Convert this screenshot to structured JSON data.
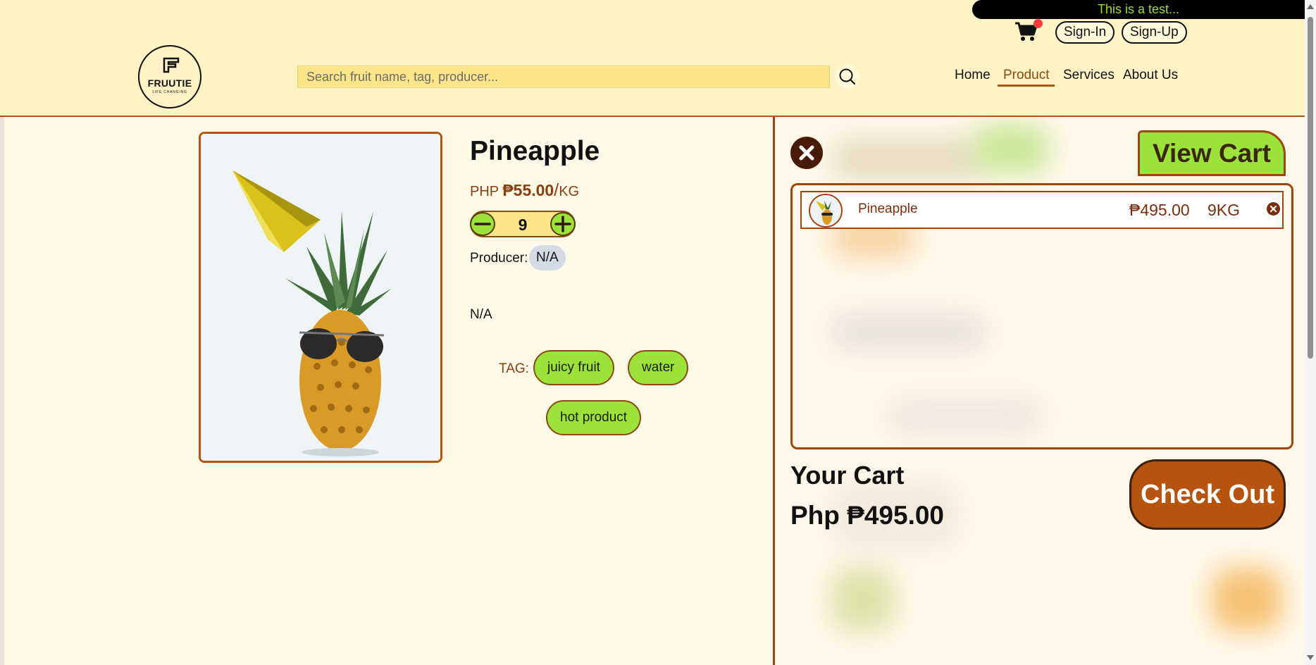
{
  "header": {
    "announcement": "This is a test...",
    "sign_in": "Sign-In",
    "sign_up": "Sign-Up",
    "logo": {
      "name": "FRUUTIE",
      "tagline": "LIFE CHANGING"
    },
    "search": {
      "placeholder": "Search fruit name, tag, producer...",
      "value": ""
    },
    "nav": [
      "Home",
      "Product",
      "Services",
      "About Us"
    ],
    "active_nav": "Product",
    "cart_badge": true
  },
  "product": {
    "name": "Pineapple",
    "currency_label": "PHP",
    "price": "₱55.00",
    "unit_sep": "/",
    "unit": "KG",
    "quantity": "9",
    "producer_label": "Producer:",
    "producer": "N/A",
    "description": "N/A",
    "tag_label": "TAG:",
    "tags": [
      "juicy fruit",
      "water",
      "hot product"
    ]
  },
  "cart": {
    "view_cart": "View Cart",
    "items": [
      {
        "name": "Pineapple",
        "price": "₱495.00",
        "qty": "9KG"
      }
    ],
    "your_cart": "Your Cart",
    "total": "Php ₱495.00",
    "checkout": "Check Out"
  },
  "colors": {
    "header_bg": "#fff3c6",
    "page_bg": "#fffae8",
    "accent_brown": "#b5530f",
    "accent_green": "#9be33a",
    "search_bg": "#fde68a"
  },
  "icons": [
    "cart-icon",
    "search-icon",
    "minus-icon",
    "plus-icon",
    "close-icon",
    "remove-item-icon"
  ]
}
